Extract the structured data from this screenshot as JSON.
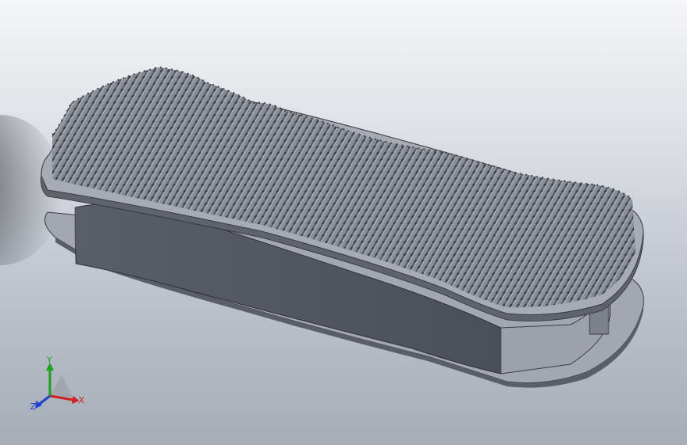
{
  "viewport": {
    "background_top": "#f4f6f8",
    "background_bottom": "#a5adb7",
    "model_color": "#4f535c",
    "model_top_color": "#a7abb3",
    "pin_color": "#6c7078"
  },
  "triad": {
    "x_label": "X",
    "y_label": "Y",
    "z_label": "Z",
    "x_color": "#d22020",
    "y_color": "#20a020",
    "z_color": "#2040d0"
  }
}
